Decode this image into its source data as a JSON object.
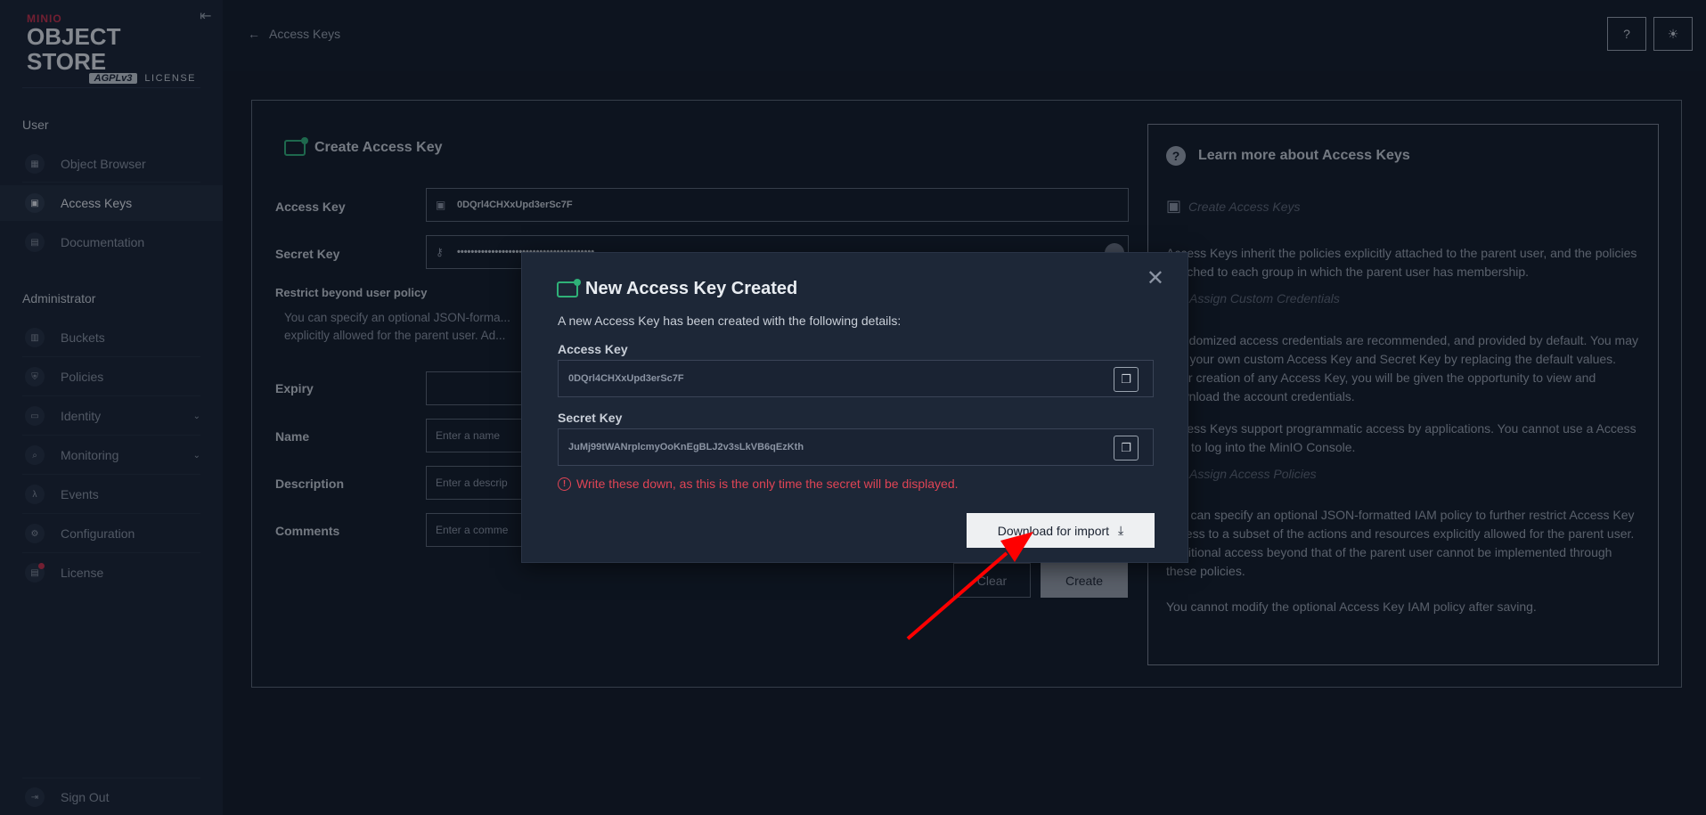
{
  "sidebar": {
    "brand": "MINIO",
    "product": "OBJECT STORE",
    "license_badge": "AGPLv3",
    "license_label": "LICENSE",
    "user_section": "User",
    "admin_section": "Administrator",
    "user_items": [
      {
        "label": "Object Browser",
        "icon": "object-browser-icon"
      },
      {
        "label": "Access Keys",
        "icon": "access-keys-icon",
        "active": true
      },
      {
        "label": "Documentation",
        "icon": "documentation-icon"
      }
    ],
    "admin_items": [
      {
        "label": "Buckets",
        "icon": "buckets-icon"
      },
      {
        "label": "Policies",
        "icon": "policies-icon"
      },
      {
        "label": "Identity",
        "icon": "identity-icon",
        "expandable": true
      },
      {
        "label": "Monitoring",
        "icon": "monitoring-icon",
        "expandable": true
      },
      {
        "label": "Events",
        "icon": "lambda-icon"
      },
      {
        "label": "Configuration",
        "icon": "gear-icon"
      },
      {
        "label": "License",
        "icon": "license-icon"
      }
    ],
    "sign_out": "Sign Out"
  },
  "header": {
    "back_label": "Access Keys"
  },
  "form": {
    "title": "Create Access Key",
    "access_key_label": "Access Key",
    "access_key_value": "0DQrl4CHXxUpd3erSc7F",
    "secret_key_label": "Secret Key",
    "secret_key_value": "••••••••••••••••••••••••••••••••••••••••",
    "restrict_label": "Restrict beyond user policy",
    "restrict_desc": "You can specify an optional JSON-forma... explicitly allowed for the parent user. Ad...",
    "expiry_label": "Expiry",
    "name_label": "Name",
    "name_placeholder": "Enter a name",
    "description_label": "Description",
    "description_placeholder": "Enter a descrip",
    "comments_label": "Comments",
    "comments_placeholder": "Enter a comme",
    "clear_label": "Clear",
    "create_label": "Create"
  },
  "help": {
    "title": "Learn more about Access Keys",
    "sub1": "Create Access Keys",
    "p1": "Access Keys inherit the policies explicitly attached to the parent user, and the policies attached to each group in which the parent user has membership.",
    "sub2": "Assign Custom Credentials",
    "p2": "Randomized access credentials are recommended, and provided by default. You may use your own custom Access Key and Secret Key by replacing the default values. After creation of any Access Key, you will be given the opportunity to view and download the account credentials.",
    "p3": "Access Keys support programmatic access by applications. You cannot use a Access Key to log into the MinIO Console.",
    "sub3": "Assign Access Policies",
    "p4": "You can specify an optional JSON-formatted IAM policy to further restrict Access Key access to a subset of the actions and resources explicitly allowed for the parent user. Additional access beyond that of the parent user cannot be implemented through these policies.",
    "p5": "You cannot modify the optional Access Key IAM policy after saving."
  },
  "modal": {
    "title": "New Access Key Created",
    "description": "A new Access Key has been created with the following details:",
    "access_key_label": "Access Key",
    "access_key_value": "0DQrl4CHXxUpd3erSc7F",
    "secret_key_label": "Secret Key",
    "secret_key_value": "JuMj99tWANrplcmyOoKnEgBLJ2v3sLkVB6qEzKth",
    "warning": "Write these down, as this is the only time the secret will be displayed.",
    "download_label": "Download for import"
  },
  "colors": {
    "accent_green": "#2fb178",
    "warning_red": "#e04455",
    "annotation_arrow": "#ff0000"
  }
}
